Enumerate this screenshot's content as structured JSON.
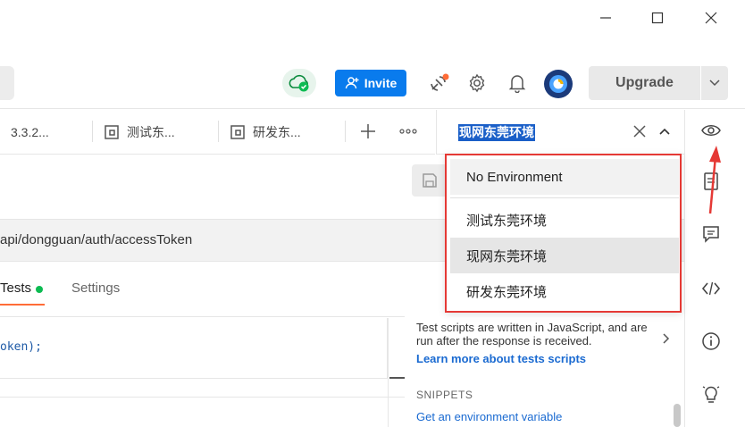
{
  "header": {
    "invite_label": "Invite",
    "upgrade_label": "Upgrade"
  },
  "tabs": [
    {
      "label": "3.3.2..."
    },
    {
      "label": "测试东..."
    },
    {
      "label": "研发东..."
    }
  ],
  "environment": {
    "selected": "现网东莞环境",
    "options": [
      {
        "label": "No Environment"
      },
      {
        "label": "测试东莞环境"
      },
      {
        "label": "现网东莞环境"
      },
      {
        "label": "研发东莞环境"
      }
    ]
  },
  "request": {
    "url": "api/dongguan/auth/accessToken",
    "subtabs": [
      {
        "label": "Tests"
      },
      {
        "label": "Settings"
      }
    ],
    "code": "oken);"
  },
  "tests_panel": {
    "description": "Test scripts are written in JavaScript, and are run after the response is received.",
    "learn_more": "Learn more about tests scripts",
    "snippets_title": "SNIPPETS",
    "snippets": [
      {
        "label": "Get an environment variable"
      }
    ]
  },
  "colors": {
    "accent": "#097bed",
    "highlight_border": "#e53935",
    "tab_underline": "#ff6c37",
    "status_green": "#0cbb52"
  }
}
